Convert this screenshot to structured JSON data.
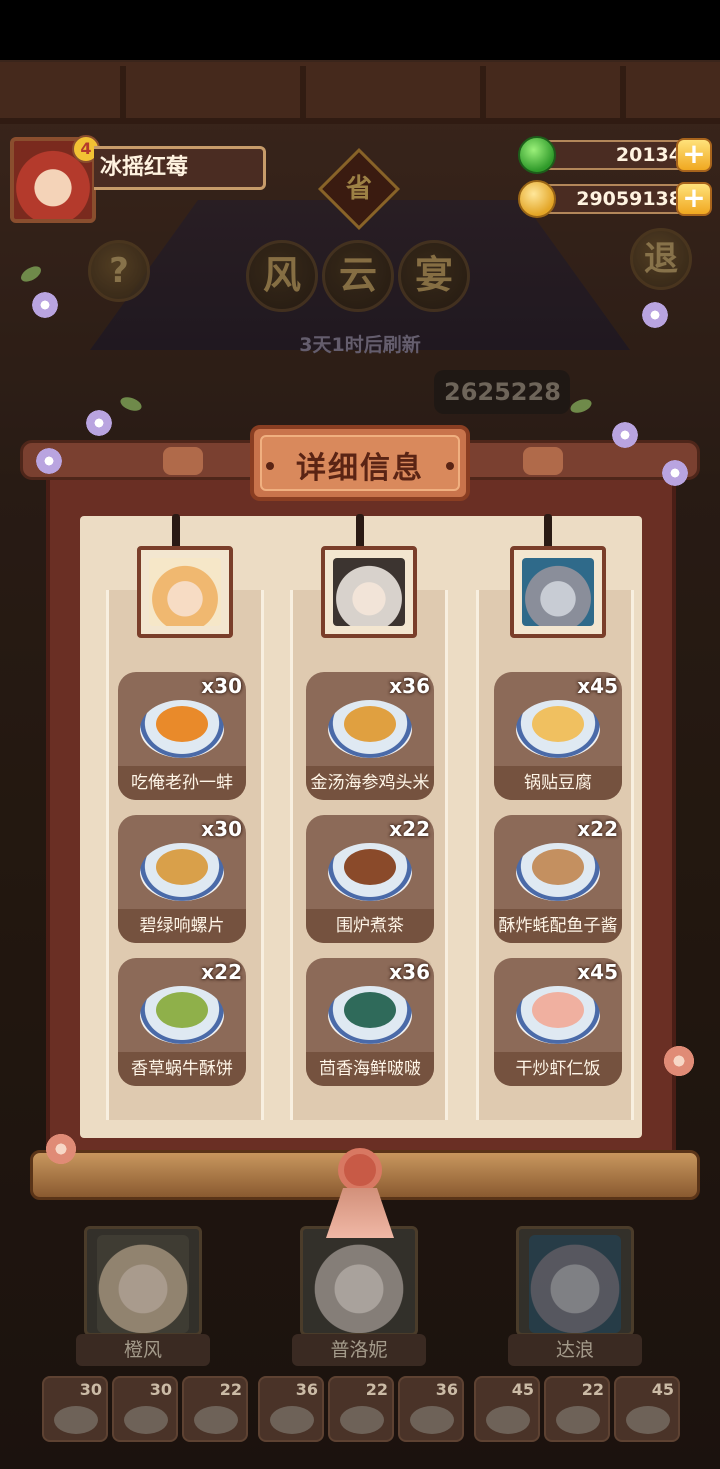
{
  "player": {
    "name": "冰摇红莓",
    "badge_char": "4"
  },
  "currency": {
    "gems": "20134",
    "coins": "29059138",
    "add_symbol": "+"
  },
  "header": {
    "help_symbol": "?",
    "exit_label": "退",
    "province_char": "省",
    "title_chars": [
      "风",
      "云",
      "宴"
    ],
    "refresh_text": "3天1时后刷新",
    "score": "2625228"
  },
  "panel": {
    "title": "详细信息",
    "columns": [
      {
        "chef": "橙风",
        "dishes": [
          {
            "name": "吃俺老孙一蚌",
            "count": "x30",
            "food_color": "#e98a2a"
          },
          {
            "name": "碧绿响螺片",
            "count": "x30",
            "food_color": "#d9a04a"
          },
          {
            "name": "香草蜗牛酥饼",
            "count": "x22",
            "food_color": "#8fb04a"
          }
        ]
      },
      {
        "chef": "普洛妮",
        "dishes": [
          {
            "name": "金汤海参鸡头米",
            "count": "x36",
            "food_color": "#e0a040"
          },
          {
            "name": "围炉煮茶",
            "count": "x22",
            "food_color": "#8a4a2a"
          },
          {
            "name": "茴香海鲜啵啵",
            "count": "x36",
            "food_color": "#2f6a5a"
          }
        ]
      },
      {
        "chef": "达浪",
        "dishes": [
          {
            "name": "锅贴豆腐",
            "count": "x45",
            "food_color": "#f0c060"
          },
          {
            "name": "酥炸蚝配鱼子酱",
            "count": "x22",
            "food_color": "#c49060"
          },
          {
            "name": "干炒虾仁饭",
            "count": "x45",
            "food_color": "#f0b0a0"
          }
        ]
      }
    ]
  },
  "bottom": {
    "chefs": [
      "橙风",
      "普洛妮",
      "达浪"
    ],
    "slots": [
      "30",
      "30",
      "22",
      "36",
      "22",
      "36",
      "45",
      "22",
      "45"
    ]
  },
  "colors": {
    "panel_frame": "#6a2f24",
    "paper": "#ecdcc4",
    "card": "#8c6a58",
    "accent_gold": "#f0a820"
  }
}
